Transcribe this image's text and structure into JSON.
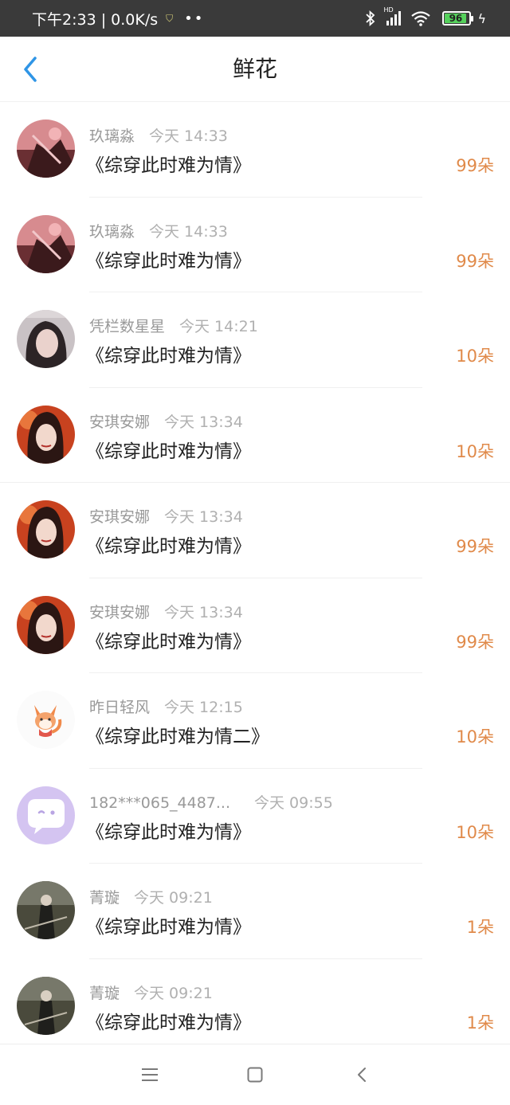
{
  "status_bar": {
    "time_speed": "下午2:33 | 0.0K/s",
    "dots": "••",
    "signal_label": "HD",
    "battery": "96"
  },
  "header": {
    "title": "鲜花"
  },
  "icons": {
    "back": "chevron-left-icon",
    "menu": "menu-icon",
    "home": "square-home-icon",
    "nav_back": "chevron-left-icon"
  },
  "colors": {
    "accent": "#2f95e6",
    "count": "#e08a4a",
    "status_bar": "#3a3a3a"
  },
  "items": [
    {
      "name": "玖璃淼",
      "time": "今天 14:33",
      "book": "《综穿此时难为情》",
      "count": "99朵"
    },
    {
      "name": "玖璃淼",
      "time": "今天 14:33",
      "book": "《综穿此时难为情》",
      "count": "99朵"
    },
    {
      "name": "凭栏数星星",
      "time": "今天 14:21",
      "book": "《综穿此时难为情》",
      "count": "10朵"
    },
    {
      "name": "安琪安娜",
      "time": "今天 13:34",
      "book": "《综穿此时难为情》",
      "count": "10朵"
    },
    {
      "name": "安琪安娜",
      "time": "今天 13:34",
      "book": "《综穿此时难为情》",
      "count": "99朵"
    },
    {
      "name": "安琪安娜",
      "time": "今天 13:34",
      "book": "《综穿此时难为情》",
      "count": "99朵"
    },
    {
      "name": "昨日轻风",
      "time": "今天 12:15",
      "book": "《综穿此时难为情二》",
      "count": "10朵"
    },
    {
      "name": "182***065_4487...",
      "time": "今天 09:55",
      "book": "《综穿此时难为情》",
      "count": "10朵"
    },
    {
      "name": "菁璇",
      "time": "今天 09:21",
      "book": "《综穿此时难为情》",
      "count": "1朵"
    },
    {
      "name": "菁璇",
      "time": "今天 09:21",
      "book": "《综穿此时难为情》",
      "count": "1朵"
    }
  ]
}
